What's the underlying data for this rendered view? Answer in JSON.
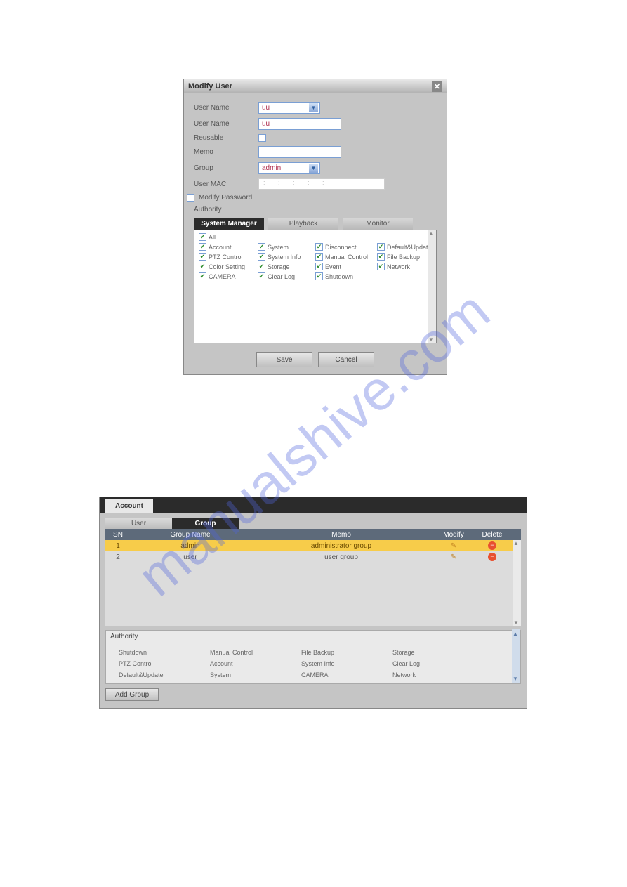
{
  "watermark": "manualshive.com",
  "dialog": {
    "title": "Modify User",
    "user_name1_label": "User Name",
    "user_name1_value": "uu",
    "user_name2_label": "User Name",
    "user_name2_value": "uu",
    "reusable_label": "Reusable",
    "memo_label": "Memo",
    "memo_value": "",
    "group_label": "Group",
    "group_value": "admin",
    "mac_label": "User MAC",
    "mac_value": ":   :   :   :   :",
    "modify_pw_label": "Modify Password",
    "authority_label": "Authority",
    "tabs": {
      "system": "System Manager",
      "playback": "Playback",
      "monitor": "Monitor"
    },
    "perms": [
      "All",
      "Account",
      "System",
      "Disconnect",
      "Default&Update",
      "PTZ Control",
      "System Info",
      "Manual Control",
      "File Backup",
      "Color Setting",
      "Storage",
      "Event",
      "Network",
      "CAMERA",
      "Clear Log",
      "Shutdown"
    ],
    "save_label": "Save",
    "cancel_label": "Cancel"
  },
  "panel": {
    "tab": "Account",
    "sub_tabs": {
      "user": "User",
      "group": "Group"
    },
    "cols": {
      "sn": "SN",
      "name": "Group Name",
      "memo": "Memo",
      "modify": "Modify",
      "delete": "Delete"
    },
    "rows": [
      {
        "sn": "1",
        "name": "admin",
        "memo": "administrator group"
      },
      {
        "sn": "2",
        "name": "user",
        "memo": "user group"
      }
    ],
    "authority_label": "Authority",
    "auth_items": [
      "Shutdown",
      "Manual Control",
      "File Backup",
      "Storage",
      "PTZ Control",
      "Account",
      "System Info",
      "Clear Log",
      "Default&Update",
      "System",
      "CAMERA",
      "Network"
    ],
    "add_group_label": "Add Group"
  }
}
